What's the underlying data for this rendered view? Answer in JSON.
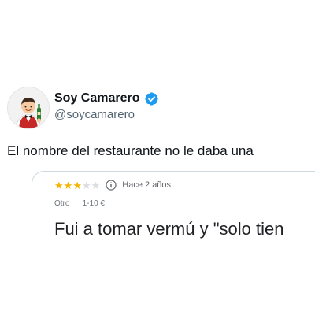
{
  "tweet": {
    "display_name": "Soy Camarero",
    "handle": "@soycamarero",
    "verified_icon": "verified-badge-icon",
    "verified_color": "#1d9bf0",
    "avatar_icon": "waiter-avatar-icon",
    "text": "El nombre del restaurante no le daba una"
  },
  "review": {
    "stars_filled": 3,
    "stars_total": 5,
    "star_color": "#f4b400",
    "info_icon": "info-circle-icon",
    "time": "Hace 2 años",
    "category": "Otro",
    "separator": "|",
    "price": "1-10 €",
    "text": "Fui a tomar vermú y \"solo tien"
  }
}
